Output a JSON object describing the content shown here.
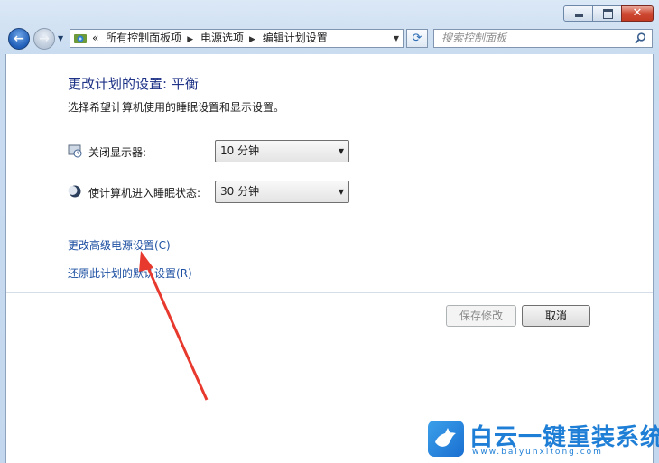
{
  "window": {
    "controls": {
      "minimize_icon": "minimize-icon",
      "maximize_icon": "maximize-icon",
      "close_glyph": "✕"
    }
  },
  "nav": {
    "back_glyph": "←",
    "forward_glyph": "→",
    "breadcrumb": {
      "overflow": "«",
      "items": [
        "所有控制面板项",
        "电源选项",
        "编辑计划设置"
      ],
      "separator": "▶"
    },
    "refresh_glyph": "⟳",
    "search": {
      "placeholder": "搜索控制面板"
    }
  },
  "page": {
    "title": "更改计划的设置: 平衡",
    "subtitle": "选择希望计算机使用的睡眠设置和显示设置。",
    "settings": [
      {
        "label": "关闭显示器:",
        "value": "10 分钟",
        "icon": "monitor-icon"
      },
      {
        "label": "使计算机进入睡眠状态:",
        "value": "30 分钟",
        "icon": "moon-icon"
      }
    ],
    "links": {
      "advanced": "更改高级电源设置(C)",
      "restore": "还原此计划的默认设置(R)"
    },
    "buttons": {
      "save": "保存修改",
      "cancel": "取消"
    }
  },
  "watermark": {
    "brand": "白云一键重装系统",
    "url": "www.baiyunxitong.com"
  },
  "colors": {
    "title": "#1e3287",
    "link": "#1e50a2",
    "annotation_arrow": "#e8392e",
    "watermark": "#1f7fd6"
  }
}
